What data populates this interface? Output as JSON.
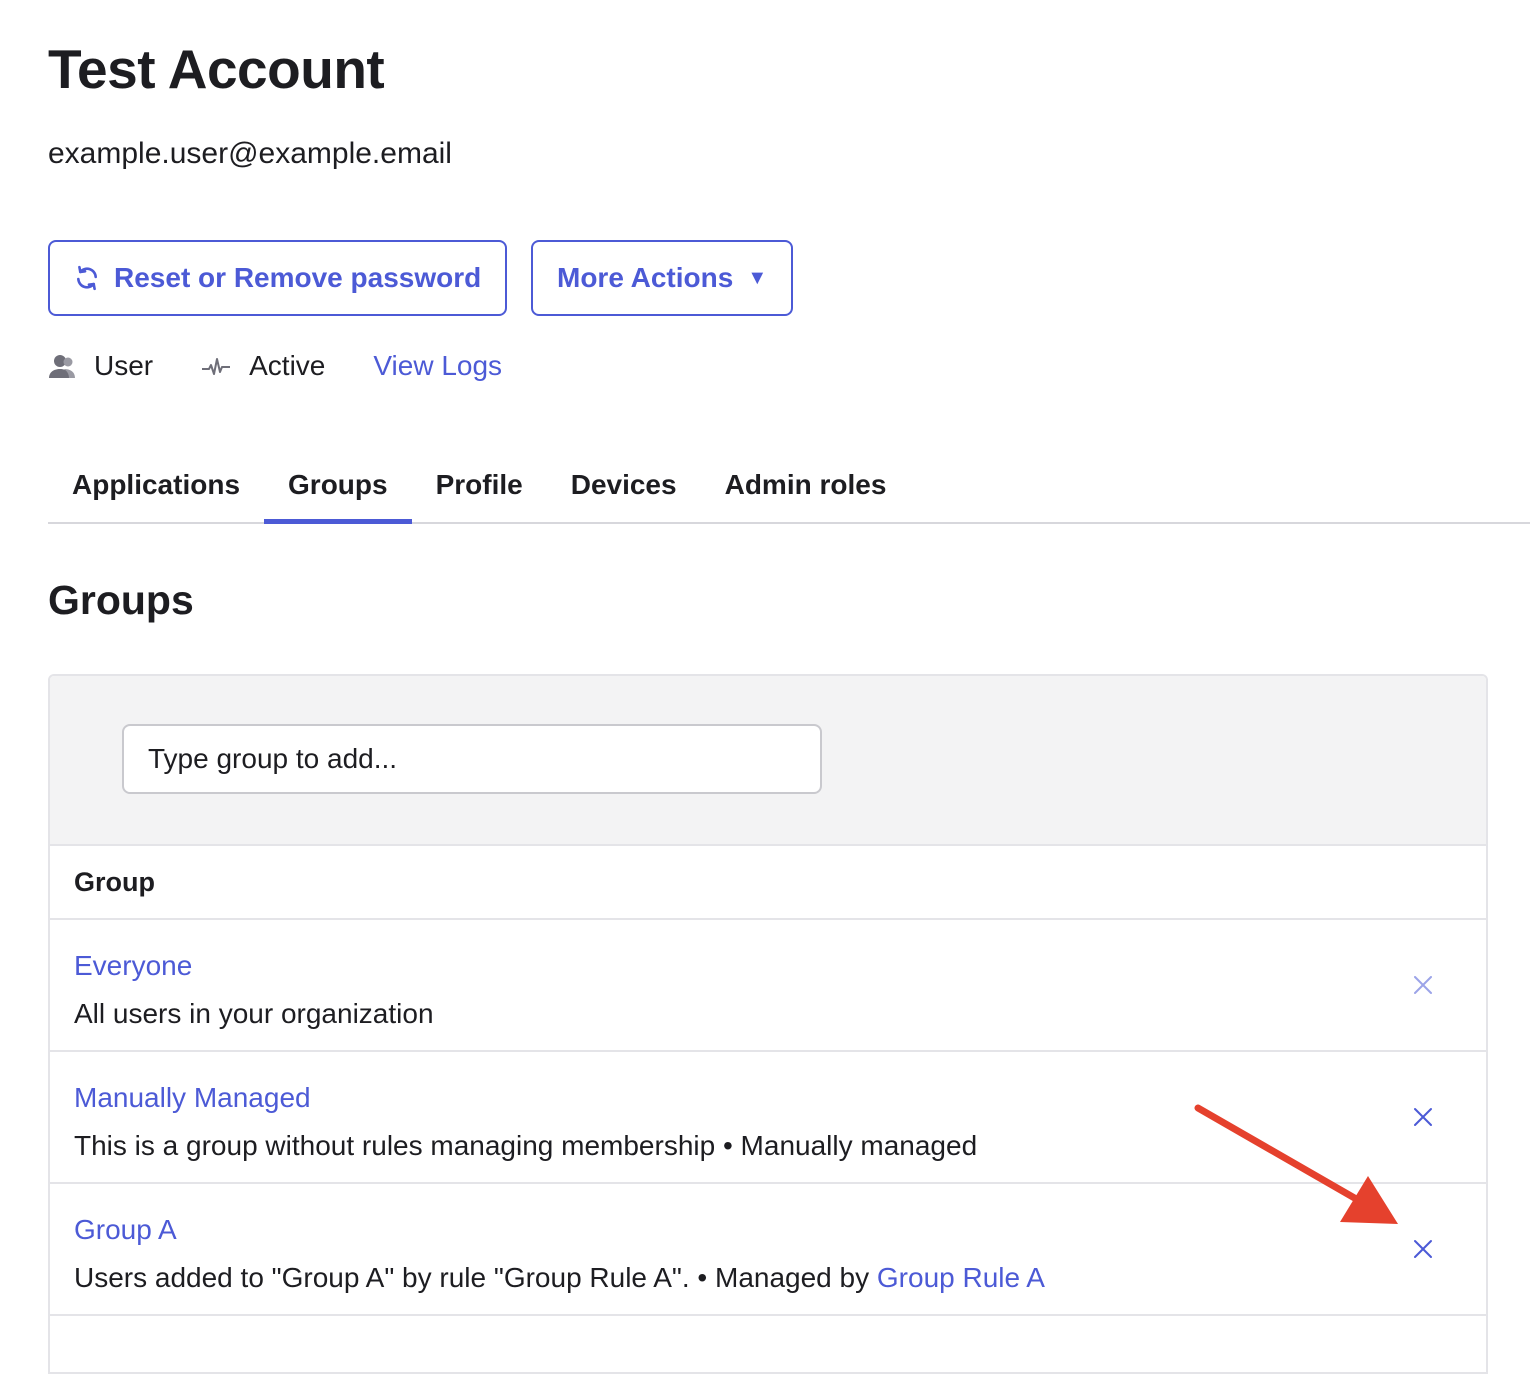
{
  "header": {
    "title": "Test Account",
    "email": "example.user@example.email"
  },
  "actions": {
    "reset_label": "Reset or Remove password",
    "more_label": "More Actions",
    "more_caret": "▼"
  },
  "meta": {
    "role_label": "User",
    "status_label": "Active",
    "logs_link": "View Logs"
  },
  "tabs": [
    {
      "label": "Applications",
      "active": false
    },
    {
      "label": "Groups",
      "active": true
    },
    {
      "label": "Profile",
      "active": false
    },
    {
      "label": "Devices",
      "active": false
    },
    {
      "label": "Admin roles",
      "active": false
    }
  ],
  "groups_section": {
    "title": "Groups",
    "search_placeholder": "Type group to add...",
    "column_header": "Group",
    "rows": [
      {
        "name": "Everyone",
        "description": "All users in your organization",
        "remove_enabled": false
      },
      {
        "name": "Manually Managed",
        "description": "This is a group without rules managing membership • Manually managed",
        "remove_enabled": true
      },
      {
        "name": "Group A",
        "description_prefix": "Users added to \"Group A\" by rule \"Group Rule A\". • Managed by ",
        "rule_link": "Group Rule A",
        "remove_enabled": true
      }
    ]
  },
  "colors": {
    "accent": "#4c5ad6",
    "text": "#1d1d21",
    "toolbar_bg": "#f3f3f4",
    "divider": "#e4e4e8",
    "annotation_arrow": "#e5412d"
  },
  "icons": {
    "reset": "refresh-icon",
    "role": "user-icon",
    "status": "activity-icon",
    "remove": "close-icon",
    "annotation": "red-arrow"
  }
}
